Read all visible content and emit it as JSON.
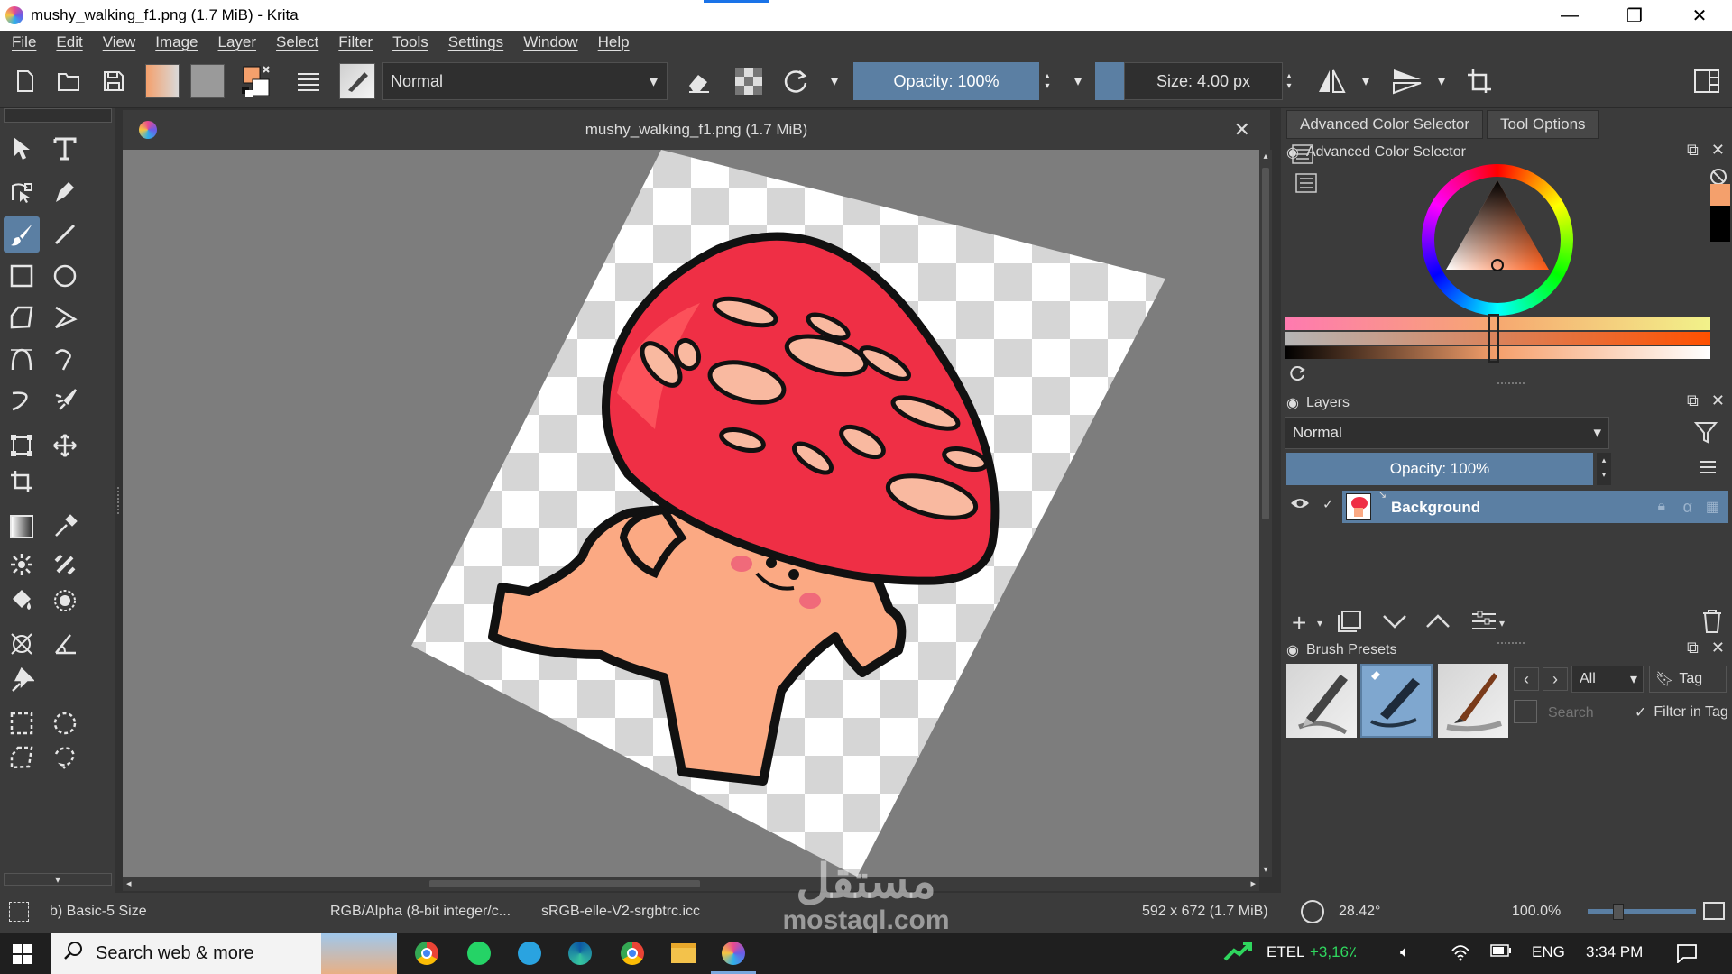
{
  "window": {
    "title": "mushy_walking_f1.png (1.7 MiB)  - Krita",
    "minimize_glyph": "—",
    "maximize_glyph": "❐",
    "close_glyph": "✕"
  },
  "menu": [
    "File",
    "Edit",
    "View",
    "Image",
    "Layer",
    "Select",
    "Filter",
    "Tools",
    "Settings",
    "Window",
    "Help"
  ],
  "toolbar": {
    "blend_mode": "Normal",
    "opacity": "Opacity: 100%",
    "size": "Size: 4.00 px"
  },
  "document_tab": {
    "title": "mushy_walking_f1.png (1.7 MiB)",
    "close_glyph": "✕"
  },
  "dock": {
    "tabs": [
      "Advanced Color Selector",
      "Tool Options"
    ],
    "color_selector": {
      "title": "Advanced Color Selector",
      "current_color": "#f4a06c",
      "secondary_color": "#000000"
    },
    "layers": {
      "title": "Layers",
      "blend_mode": "Normal",
      "opacity": "Opacity:  100%",
      "items": [
        {
          "name": "Background",
          "visible": true,
          "checked": true
        }
      ]
    },
    "brush_presets": {
      "title": "Brush Presets",
      "filter": "All",
      "tag_label": "Tag",
      "search_placeholder": "Search",
      "filter_in_tag": "Filter in Tag",
      "prev_glyph": "‹",
      "next_glyph": "›"
    }
  },
  "status": {
    "brush": "b) Basic-5 Size",
    "color_model": "RGB/Alpha (8-bit integer/c...",
    "profile": "sRGB-elle-V2-srgbtrc.icc",
    "dimensions": "592 x 672 (1.7 MiB)",
    "rotation": "28.42°",
    "zoom": "100.0%"
  },
  "taskbar": {
    "search_text": "Search web & more",
    "network_name": "ETEL",
    "network_change": "+3,16٪",
    "language": "ENG",
    "clock": "3:34 PM"
  },
  "watermark": {
    "arabic": "مستقل",
    "latin": "mostaql.com"
  },
  "colors": {
    "accent": "#5b7fa3",
    "panel_bg": "#3b3b3b",
    "canvas_bg": "#7d7d7d",
    "mushroom_cap": "#ef2f45",
    "mushroom_body": "#fba983"
  }
}
